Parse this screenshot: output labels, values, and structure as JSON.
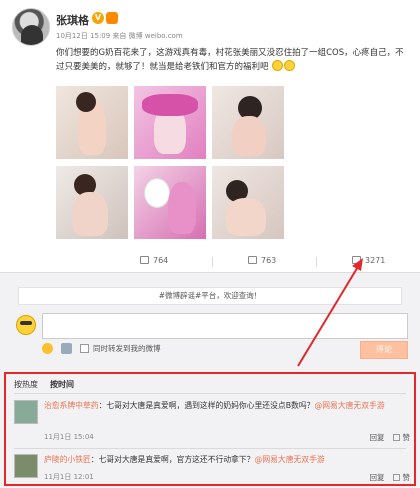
{
  "post": {
    "username": "张琪格",
    "meta": "10月12日 15:09 来自 微博 weibo.com",
    "text": "你们想要的G奶百花来了，这游戏真有毒，村花张美丽又没忍住拍了一组COS，心疼自己，不过只要美美的，就够了！就当是给老铁们和官方的福利吧",
    "actions": {
      "forward": "764",
      "comment": "763",
      "like": "3271"
    }
  },
  "comment_box": {
    "notice": "#微博辟谣#平台，欢迎查询！",
    "forward_checkbox": "同时转发到我的微博",
    "submit": "评论"
  },
  "comments": {
    "sort": {
      "hot": "按热度",
      "time": "按时间"
    },
    "items": [
      {
        "user": "治愈系牌中草药",
        "text": "：七哥对大唐是真爱啊，遇到这样的奶妈你心里还没点B数吗？",
        "mention": "@网易大唐无双手游",
        "time": "11月1日 15:04",
        "reply": "回复",
        "like": "赞"
      },
      {
        "user": "庐陵的小铁匠",
        "text": "：七哥对大唐是真爱啊，官方这还不行动拿下？",
        "mention": "@网易大唐无双手游",
        "time": "11月1日 12:01",
        "reply": "回复",
        "like": "赞"
      }
    ]
  },
  "colors": {
    "accent": "#eb7350",
    "highlight": "#e3272b",
    "vip": "#f7a600"
  }
}
